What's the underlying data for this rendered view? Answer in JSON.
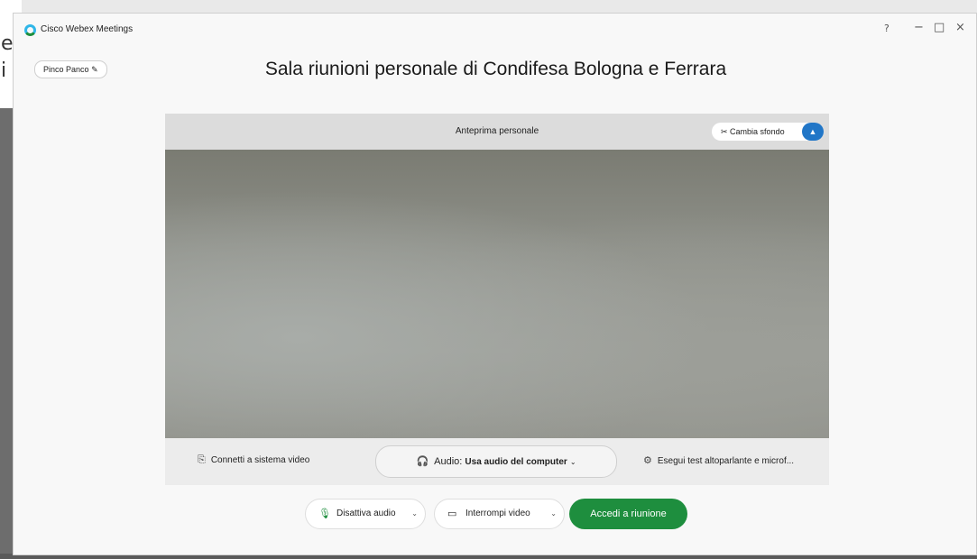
{
  "window": {
    "app_title": "Cisco Webex Meetings",
    "controls": {
      "help": "?",
      "minimize": "−",
      "maximize": "□",
      "close": "×"
    }
  },
  "user": {
    "name": "Pinco Panco"
  },
  "room_title": "Sala riunioni personale di Condifesa Bologna e Ferrara",
  "preview": {
    "label": "Anteprima personale",
    "background_button": "Cambia sfondo"
  },
  "toolbar": {
    "connect_video": "Connetti a sistema video",
    "audio_prefix": "Audio:",
    "audio_value": "Usa audio del computer",
    "test_speaker": "Esegui test altoparlante e microf..."
  },
  "controls": {
    "mute": "Disattiva audio",
    "stop_video": "Interrompi video",
    "join": "Accedi a riunione"
  },
  "background_doc": {
    "line1": "e",
    "line2": "i"
  },
  "colors": {
    "join": "#1e8e3e",
    "accent": "#2176c7"
  }
}
